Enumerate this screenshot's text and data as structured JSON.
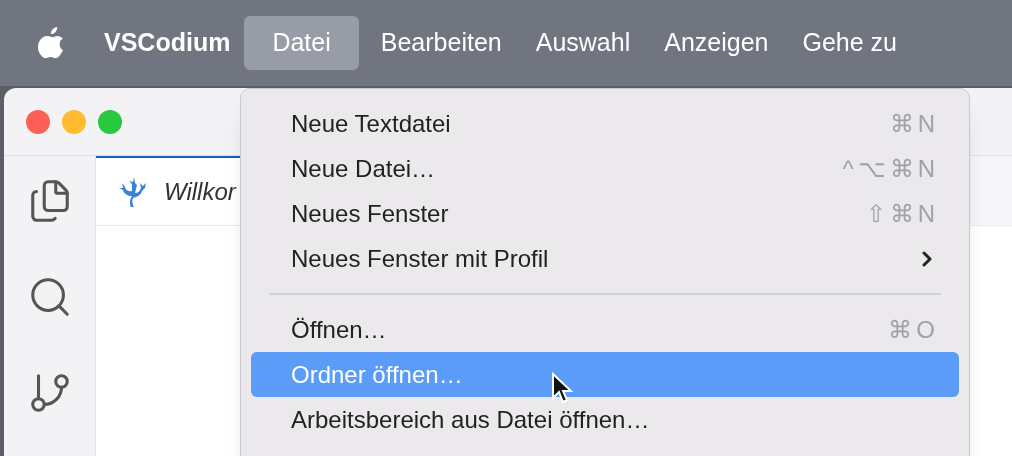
{
  "menubar": {
    "app_name": "VSCodium",
    "menus": [
      {
        "label": "Datei",
        "selected": true
      },
      {
        "label": "Bearbeiten",
        "selected": false
      },
      {
        "label": "Auswahl",
        "selected": false
      },
      {
        "label": "Anzeigen",
        "selected": false
      },
      {
        "label": "Gehe zu",
        "selected": false
      }
    ]
  },
  "editor_tab": {
    "label": "Willkor"
  },
  "menu": [
    {
      "kind": "item",
      "label": "Neue Textdatei",
      "shortcut": "⌘N",
      "submenu": false,
      "selected": false
    },
    {
      "kind": "item",
      "label": "Neue Datei…",
      "shortcut": "^⌥⌘N",
      "submenu": false,
      "selected": false
    },
    {
      "kind": "item",
      "label": "Neues Fenster",
      "shortcut": "⇧⌘N",
      "submenu": false,
      "selected": false
    },
    {
      "kind": "item",
      "label": "Neues Fenster mit Profil",
      "submenu": true,
      "selected": false
    },
    {
      "kind": "separator"
    },
    {
      "kind": "item",
      "label": "Öffnen…",
      "shortcut": "⌘O",
      "submenu": false,
      "selected": false
    },
    {
      "kind": "item",
      "label": "Ordner öffnen…",
      "submenu": false,
      "selected": true
    },
    {
      "kind": "item",
      "label": "Arbeitsbereich aus Datei öffnen…",
      "submenu": false,
      "selected": false
    }
  ]
}
